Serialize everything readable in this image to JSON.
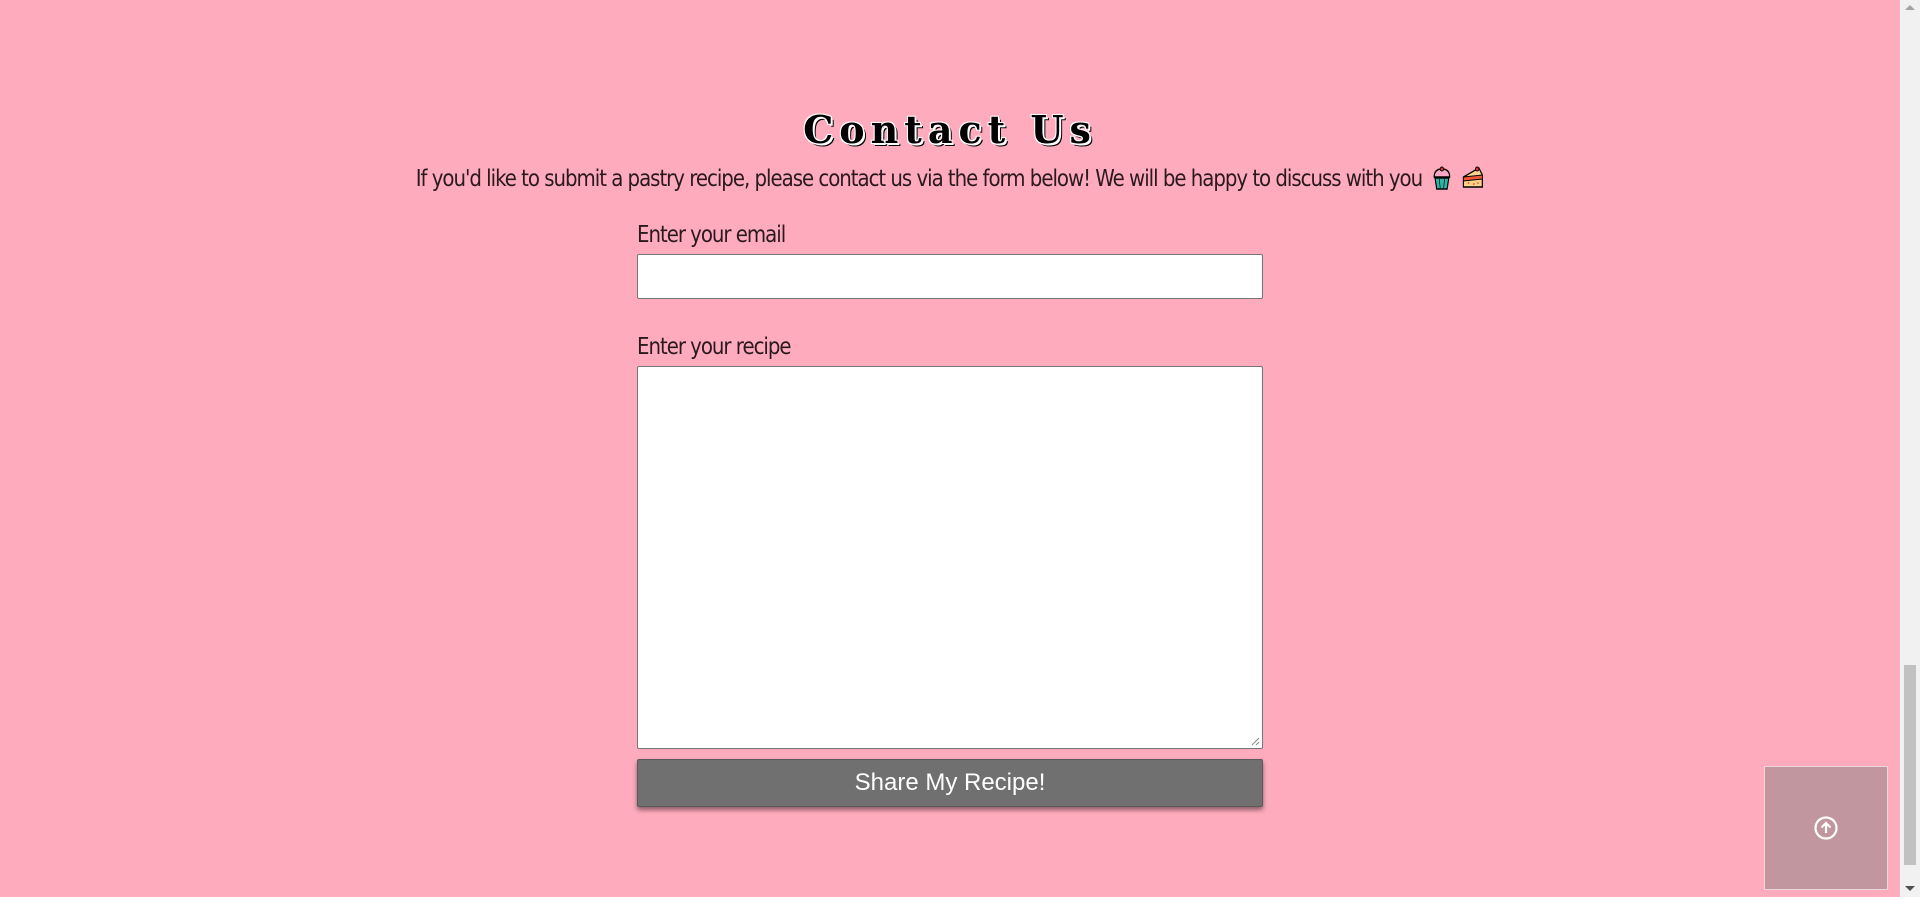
{
  "contact": {
    "title": "Contact Us",
    "intro": "If you'd like to submit a pastry recipe, please contact us via the form below! We will be happy to discuss with you"
  },
  "form": {
    "email_label": "Enter your email",
    "email_value": "",
    "recipe_label": "Enter your recipe",
    "recipe_value": "",
    "submit_label": "Share My Recipe!"
  },
  "icons": {
    "intro_emojis": [
      "cupcake-icon",
      "cake-slice-icon"
    ],
    "back_to_top": "arrow-up-circle-icon"
  },
  "colors": {
    "background": "#ffabbe",
    "button": "#707070",
    "back_to_top": "#c2969f"
  }
}
